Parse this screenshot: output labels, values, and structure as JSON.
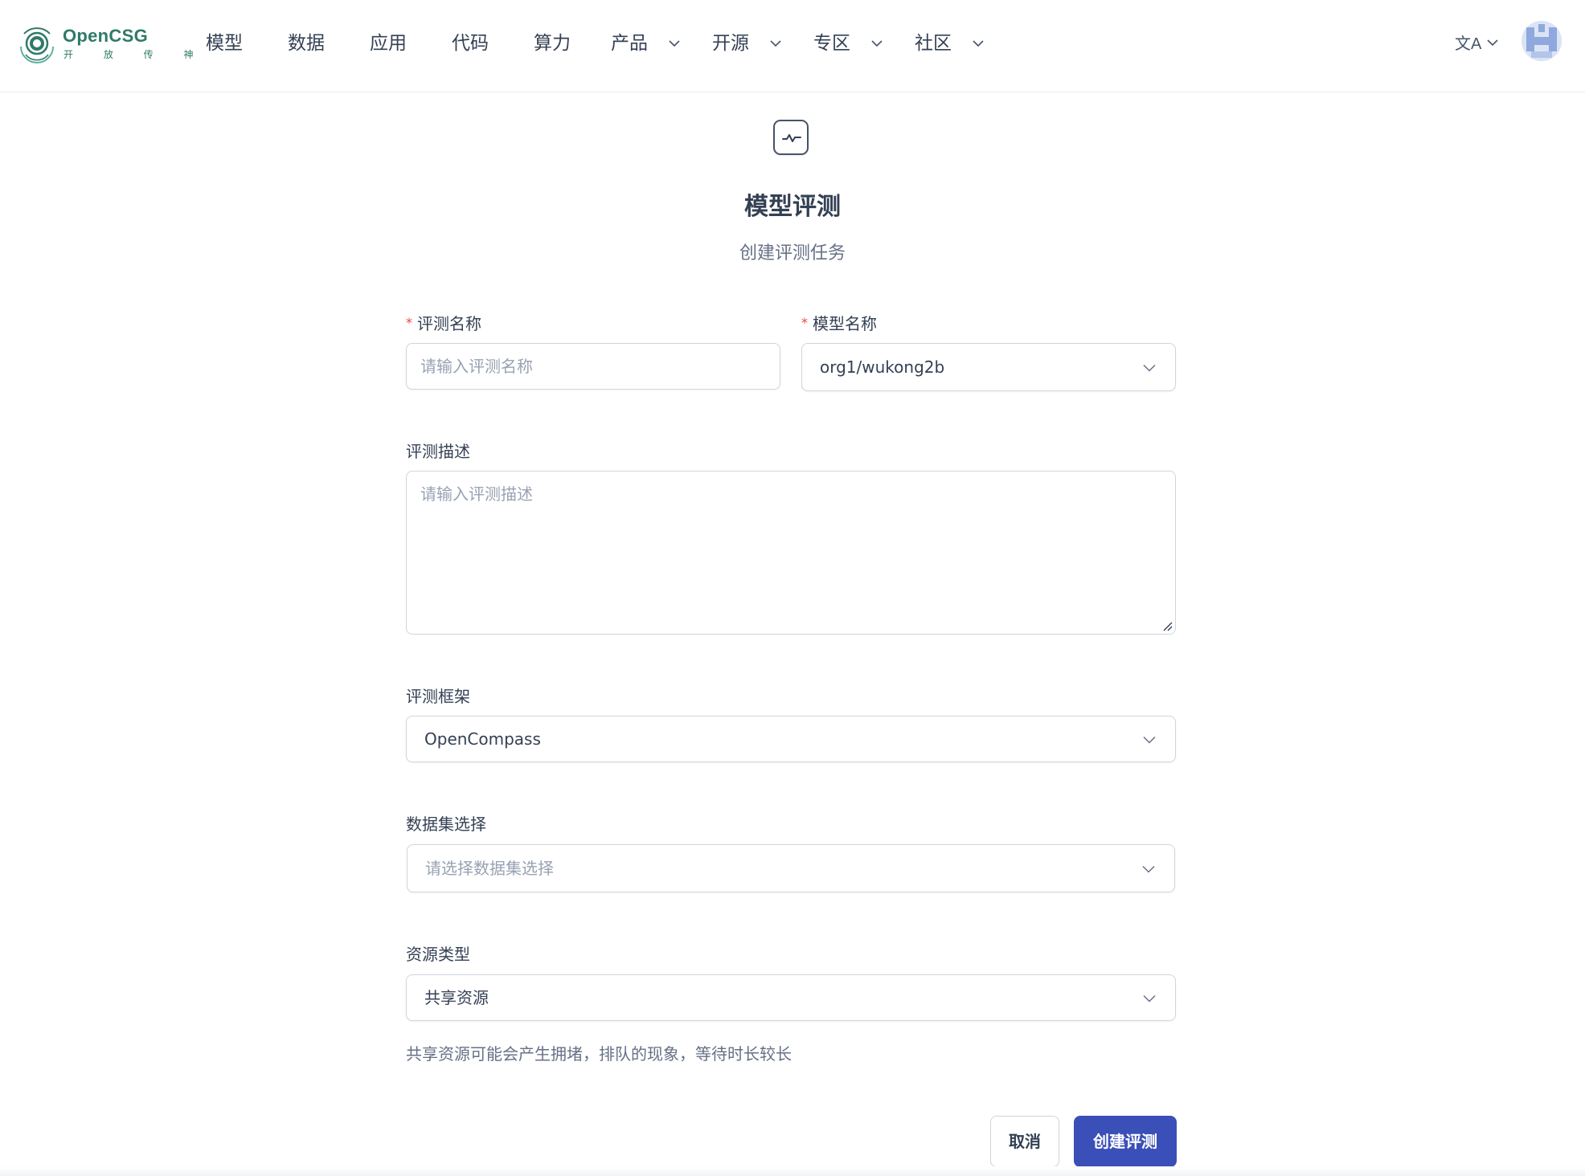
{
  "brand": {
    "name": "OpenCSG",
    "tagline": "开 放 传 神",
    "color": "#2f7a68"
  },
  "nav": {
    "items": [
      {
        "label": "模型",
        "dropdown": false
      },
      {
        "label": "数据",
        "dropdown": false
      },
      {
        "label": "应用",
        "dropdown": false
      },
      {
        "label": "代码",
        "dropdown": false
      },
      {
        "label": "算力",
        "dropdown": false
      },
      {
        "label": "产品",
        "dropdown": true
      },
      {
        "label": "开源",
        "dropdown": true
      },
      {
        "label": "专区",
        "dropdown": true
      },
      {
        "label": "社区",
        "dropdown": true
      }
    ],
    "language_icon": "translate-icon",
    "language_glyph": "文A"
  },
  "header_icon": "activity-chart-icon",
  "title": "模型评测",
  "subtitle": "创建评测任务",
  "form": {
    "eval_name": {
      "label": "评测名称",
      "required": true,
      "placeholder": "请输入评测名称",
      "value": ""
    },
    "model_name": {
      "label": "模型名称",
      "required": true,
      "value": "org1/wukong2b"
    },
    "description": {
      "label": "评测描述",
      "placeholder": "请输入评测描述",
      "value": ""
    },
    "framework": {
      "label": "评测框架",
      "value": "OpenCompass"
    },
    "dataset": {
      "label": "数据集选择",
      "placeholder": "请选择数据集选择",
      "value": ""
    },
    "resource_type": {
      "label": "资源类型",
      "value": "共享资源",
      "hint": "共享资源可能会产生拥堵，排队的现象，等待时长较长"
    }
  },
  "buttons": {
    "cancel": "取消",
    "submit": "创建评测"
  },
  "colors": {
    "primary": "#3b4fb8",
    "required": "#f04438",
    "text": "#344054",
    "placeholder": "#98a2b3"
  }
}
